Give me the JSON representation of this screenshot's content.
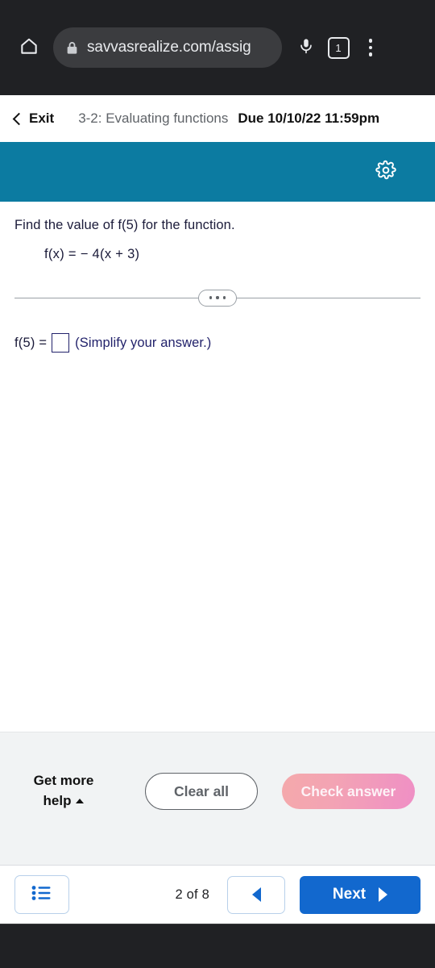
{
  "browser": {
    "home_icon": "home-icon",
    "lock_icon": "lock-icon",
    "url": "savvasrealize.com/assig",
    "mic_icon": "microphone-icon",
    "tab_count": "1",
    "menu_icon": "kebab-menu-icon"
  },
  "assignment": {
    "exit_label": "Exit",
    "title": "3-2: Evaluating functions",
    "due": "Due 10/10/22 11:59pm",
    "settings_icon": "gear-icon",
    "toolbar_color": "#0c7ba1"
  },
  "problem": {
    "prompt": "Find the value of f(5) for the function.",
    "equation": "f(x) =  − 4(x + 3)",
    "expander_icon": "ellipsis-expander",
    "answer_label": "f(5) =",
    "answer_value": "",
    "answer_placeholder": "",
    "answer_hint": "(Simplify your answer.)"
  },
  "actions": {
    "get_help_line1": "Get more",
    "get_help_line2": "help",
    "get_help_caret": "caret-up-icon",
    "clear_all_label": "Clear all",
    "check_answer_label": "Check answer",
    "check_answer_color": "#ef8fc5"
  },
  "navigation": {
    "list_icon": "bulleted-list-icon",
    "page_count": "2 of 8",
    "prev_icon": "triangle-left-icon",
    "next_label": "Next",
    "next_icon": "triangle-right-icon",
    "next_color": "#1268ce"
  }
}
